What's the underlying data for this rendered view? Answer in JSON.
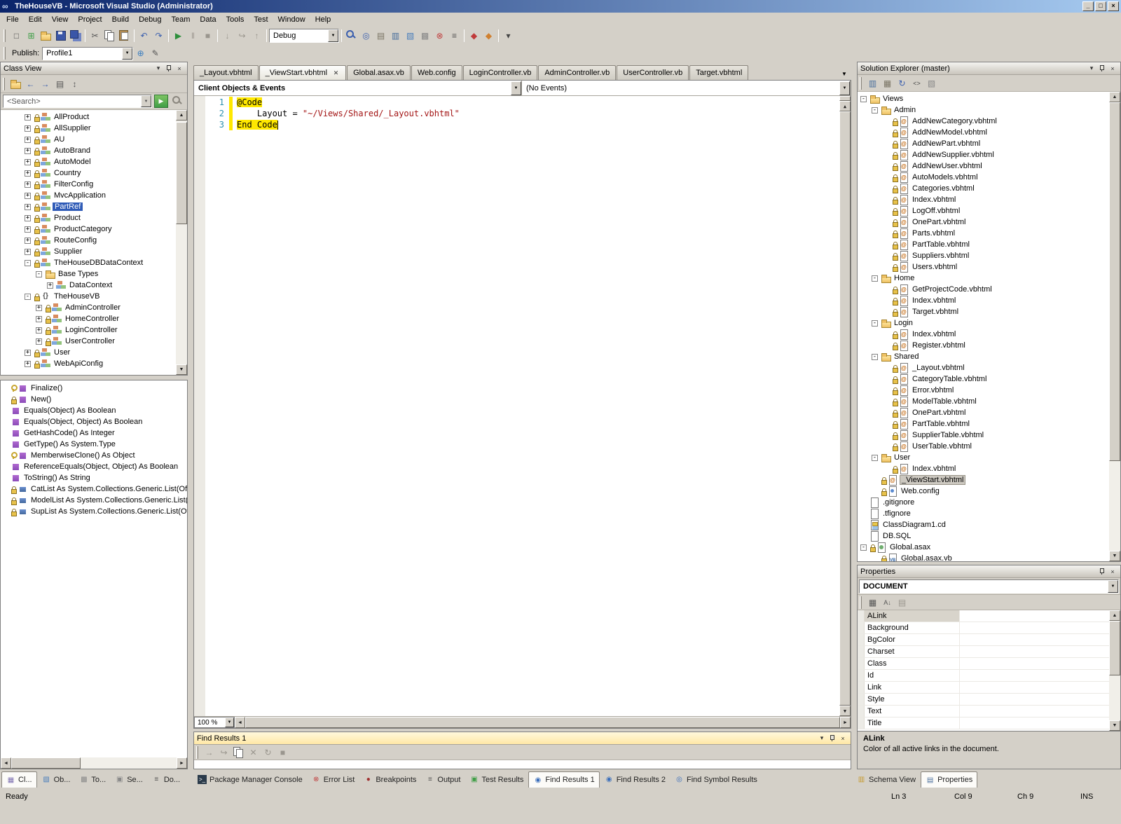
{
  "window": {
    "title": "TheHouseVB - Microsoft Visual Studio (Administrator)",
    "status": "Ready",
    "status_cells": [
      "Ln 3",
      "Col 9",
      "Ch 9",
      "INS"
    ]
  },
  "colors": {
    "titlebar_left": "#0a246a",
    "titlebar_right": "#a6caf0",
    "chrome": "#d4d0c8",
    "selection": "#2f5bb7",
    "razor_highlight": "#ffe800",
    "string_text": "#a31515",
    "line_number": "#2b91af",
    "focused_header": "#ffe8a6"
  },
  "menu": {
    "items": [
      "File",
      "Edit",
      "View",
      "Project",
      "Build",
      "Debug",
      "Team",
      "Data",
      "Tools",
      "Test",
      "Window",
      "Help"
    ]
  },
  "main_toolbar": {
    "groups_before_combo": [
      [
        "new-item",
        "add-item",
        "open-file",
        "save",
        "save-all"
      ],
      [
        "cut",
        "copy",
        "paste"
      ],
      [
        "undo",
        "redo"
      ],
      [
        "start-debugging",
        "break-all",
        "stop-debugging"
      ],
      [
        "step-into",
        "step-over",
        "step-out"
      ]
    ],
    "debug_combo": "Debug",
    "groups_after_combo": [
      [
        "find-in-files",
        "find-next",
        "solution-explorer",
        "properties-window",
        "object-browser",
        "toolbox",
        "error-list",
        "output-window"
      ],
      [
        "extension-red",
        "extension-orange"
      ],
      [
        "toolbar-options"
      ]
    ],
    "disabled": [
      "break-all",
      "stop-debugging",
      "step-into",
      "step-over",
      "step-out"
    ]
  },
  "publish_bar": {
    "label": "Publish:",
    "profile": "Profile1",
    "buttons": [
      "publish-web",
      "publish-settings"
    ]
  },
  "class_view": {
    "title": "Class View",
    "toolbar": [
      "new-folder",
      "back",
      "forward",
      "view-menu",
      "sort"
    ],
    "search_value": "<Search>",
    "tree": [
      {
        "label": "AllProduct",
        "level": 0,
        "exp": "+",
        "icon": "class",
        "lock": true
      },
      {
        "label": "AllSupplier",
        "level": 0,
        "exp": "+",
        "icon": "class",
        "lock": true
      },
      {
        "label": "AU",
        "level": 0,
        "exp": "+",
        "icon": "class",
        "lock": true
      },
      {
        "label": "AutoBrand",
        "level": 0,
        "exp": "+",
        "icon": "class",
        "lock": true
      },
      {
        "label": "AutoModel",
        "level": 0,
        "exp": "+",
        "icon": "class",
        "lock": true
      },
      {
        "label": "Country",
        "level": 0,
        "exp": "+",
        "icon": "class",
        "lock": true
      },
      {
        "label": "FilterConfig",
        "level": 0,
        "exp": "+",
        "icon": "class",
        "lock": true
      },
      {
        "label": "MvcApplication",
        "level": 0,
        "exp": "+",
        "icon": "class",
        "lock": true
      },
      {
        "label": "PartRef",
        "level": 0,
        "exp": "+",
        "icon": "class",
        "lock": true,
        "selected": true
      },
      {
        "label": "Product",
        "level": 0,
        "exp": "+",
        "icon": "class",
        "lock": true
      },
      {
        "label": "ProductCategory",
        "level": 0,
        "exp": "+",
        "icon": "class",
        "lock": true
      },
      {
        "label": "RouteConfig",
        "level": 0,
        "exp": "+",
        "icon": "class",
        "lock": true
      },
      {
        "label": "Supplier",
        "level": 0,
        "exp": "+",
        "icon": "class",
        "lock": true
      },
      {
        "label": "TheHouseDBDataContext",
        "level": 0,
        "exp": "-",
        "icon": "class",
        "lock": true
      },
      {
        "label": "Base Types",
        "level": 1,
        "exp": "-",
        "icon": "folder"
      },
      {
        "label": "DataContext",
        "level": 2,
        "exp": "+",
        "icon": "class"
      },
      {
        "label": "TheHouseVB",
        "level": 0,
        "exp": "-",
        "icon": "namespace",
        "lock": true
      },
      {
        "label": "AdminController",
        "level": 1,
        "exp": "+",
        "icon": "class",
        "lock": true
      },
      {
        "label": "HomeController",
        "level": 1,
        "exp": "+",
        "icon": "class",
        "lock": true
      },
      {
        "label": "LoginController",
        "level": 1,
        "exp": "+",
        "icon": "class",
        "lock": true
      },
      {
        "label": "UserController",
        "level": 1,
        "exp": "+",
        "icon": "class",
        "lock": true
      },
      {
        "label": "User",
        "level": 0,
        "exp": "+",
        "icon": "class",
        "lock": true
      },
      {
        "label": "WebApiConfig",
        "level": 0,
        "exp": "+",
        "icon": "class",
        "lock": true
      }
    ],
    "members": [
      {
        "label": "Finalize()",
        "icon": "method",
        "modifier": "protected"
      },
      {
        "label": "New()",
        "icon": "method",
        "modifier": "friend"
      },
      {
        "label": "Equals(Object) As Boolean",
        "icon": "method"
      },
      {
        "label": "Equals(Object, Object) As Boolean",
        "icon": "method"
      },
      {
        "label": "GetHashCode() As Integer",
        "icon": "method"
      },
      {
        "label": "GetType() As System.Type",
        "icon": "method"
      },
      {
        "label": "MemberwiseClone() As Object",
        "icon": "method",
        "modifier": "protected"
      },
      {
        "label": "ReferenceEquals(Object, Object) As Boolean",
        "icon": "method"
      },
      {
        "label": "ToString() As String",
        "icon": "method"
      },
      {
        "label": "CatList As System.Collections.Generic.List(Of",
        "icon": "property",
        "modifier": "friend"
      },
      {
        "label": "ModelList As System.Collections.Generic.List(",
        "icon": "property",
        "modifier": "friend"
      },
      {
        "label": "SupList As System.Collections.Generic.List(Of",
        "icon": "property",
        "modifier": "friend"
      }
    ]
  },
  "editor": {
    "tabs": [
      {
        "label": "_Layout.vbhtml"
      },
      {
        "label": "_ViewStart.vbhtml",
        "active": true,
        "close": true
      },
      {
        "label": "Global.asax.vb"
      },
      {
        "label": "Web.config"
      },
      {
        "label": "LoginController.vb"
      },
      {
        "label": "AdminController.vb"
      },
      {
        "label": "UserController.vb"
      },
      {
        "label": "Target.vbhtml"
      }
    ],
    "nav_left": "Client Objects & Events",
    "nav_right": "(No Events)",
    "code_lines": [
      {
        "num": "1",
        "segments": [
          {
            "text": "@Code",
            "style": "razor"
          }
        ]
      },
      {
        "num": "2",
        "segments": [
          {
            "text": "    Layout = ",
            "style": "plain"
          },
          {
            "text": "\"~/Views/Shared/_Layout.vbhtml\"",
            "style": "string"
          }
        ]
      },
      {
        "num": "3",
        "segments": [
          {
            "text": "End Code",
            "style": "razor"
          }
        ],
        "caret": true
      }
    ],
    "zoom": "100 %"
  },
  "find_results": {
    "title": "Find Results 1",
    "toolbar": [
      "goto-location",
      "goto-next",
      "copy-results",
      "clear-results",
      "repeat-search",
      "stop-search"
    ]
  },
  "solution_explorer": {
    "title": "Solution Explorer (master)",
    "toolbar": [
      "show-properties",
      "show-all-files",
      "refresh",
      "view-code",
      "view-designer"
    ],
    "tree": [
      {
        "label": "Views",
        "level": 0,
        "exp": "-",
        "icon": "folder"
      },
      {
        "label": "Admin",
        "level": 1,
        "exp": "-",
        "icon": "folder"
      },
      {
        "label": "AddNewCategory.vbhtml",
        "level": 2,
        "icon": "razor",
        "lock": true
      },
      {
        "label": "AddNewModel.vbhtml",
        "level": 2,
        "icon": "razor",
        "lock": true
      },
      {
        "label": "AddNewPart.vbhtml",
        "level": 2,
        "icon": "razor",
        "lock": true
      },
      {
        "label": "AddNewSupplier.vbhtml",
        "level": 2,
        "icon": "razor",
        "lock": true
      },
      {
        "label": "AddNewUser.vbhtml",
        "level": 2,
        "icon": "razor",
        "lock": true
      },
      {
        "label": "AutoModels.vbhtml",
        "level": 2,
        "icon": "razor",
        "lock": true
      },
      {
        "label": "Categories.vbhtml",
        "level": 2,
        "icon": "razor",
        "lock": true
      },
      {
        "label": "Index.vbhtml",
        "level": 2,
        "icon": "razor",
        "lock": true
      },
      {
        "label": "LogOff.vbhtml",
        "level": 2,
        "icon": "razor",
        "lock": true
      },
      {
        "label": "OnePart.vbhtml",
        "level": 2,
        "icon": "razor",
        "lock": true
      },
      {
        "label": "Parts.vbhtml",
        "level": 2,
        "icon": "razor",
        "lock": true
      },
      {
        "label": "PartTable.vbhtml",
        "level": 2,
        "icon": "razor",
        "lock": true
      },
      {
        "label": "Suppliers.vbhtml",
        "level": 2,
        "icon": "razor",
        "lock": true
      },
      {
        "label": "Users.vbhtml",
        "level": 2,
        "icon": "razor",
        "lock": true
      },
      {
        "label": "Home",
        "level": 1,
        "exp": "-",
        "icon": "folder"
      },
      {
        "label": "GetProjectCode.vbhtml",
        "level": 2,
        "icon": "razor",
        "lock": true
      },
      {
        "label": "Index.vbhtml",
        "level": 2,
        "icon": "razor",
        "lock": true
      },
      {
        "label": "Target.vbhtml",
        "level": 2,
        "icon": "razor",
        "lock": true
      },
      {
        "label": "Login",
        "level": 1,
        "exp": "-",
        "icon": "folder"
      },
      {
        "label": "Index.vbhtml",
        "level": 2,
        "icon": "razor",
        "lock": true
      },
      {
        "label": "Register.vbhtml",
        "level": 2,
        "icon": "razor",
        "lock": true
      },
      {
        "label": "Shared",
        "level": 1,
        "exp": "-",
        "icon": "folder"
      },
      {
        "label": "_Layout.vbhtml",
        "level": 2,
        "icon": "razor",
        "lock": true
      },
      {
        "label": "CategoryTable.vbhtml",
        "level": 2,
        "icon": "razor",
        "lock": true
      },
      {
        "label": "Error.vbhtml",
        "level": 2,
        "icon": "razor",
        "lock": true
      },
      {
        "label": "ModelTable.vbhtml",
        "level": 2,
        "icon": "razor",
        "lock": true
      },
      {
        "label": "OnePart.vbhtml",
        "level": 2,
        "icon": "razor",
        "lock": true
      },
      {
        "label": "PartTable.vbhtml",
        "level": 2,
        "icon": "razor",
        "lock": true
      },
      {
        "label": "SupplierTable.vbhtml",
        "level": 2,
        "icon": "razor",
        "lock": true
      },
      {
        "label": "UserTable.vbhtml",
        "level": 2,
        "icon": "razor",
        "lock": true
      },
      {
        "label": "User",
        "level": 1,
        "exp": "-",
        "icon": "folder"
      },
      {
        "label": "Index.vbhtml",
        "level": 2,
        "icon": "razor",
        "lock": true
      },
      {
        "label": "_ViewStart.vbhtml",
        "level": 1,
        "icon": "razor",
        "lock": true,
        "selected": true
      },
      {
        "label": "Web.config",
        "level": 1,
        "icon": "config",
        "lock": true
      },
      {
        "label": ".gitignore",
        "level": 0,
        "icon": "file"
      },
      {
        "label": ".tfignore",
        "level": 0,
        "icon": "file"
      },
      {
        "label": "ClassDiagram1.cd",
        "level": 0,
        "icon": "diagram"
      },
      {
        "label": "DB.SQL",
        "level": 0,
        "icon": "file"
      },
      {
        "label": "Global.asax",
        "level": 0,
        "exp": "-",
        "icon": "asax",
        "lock": true
      },
      {
        "label": "Global.asax.vb",
        "level": 1,
        "icon": "vb",
        "lock": true
      }
    ]
  },
  "properties": {
    "title": "Properties",
    "object_name": "DOCUMENT",
    "toolbar": [
      "categorized",
      "alphabetical",
      "property-pages"
    ],
    "rows": [
      {
        "name": "ALink",
        "value": "",
        "selected": true
      },
      {
        "name": "Background",
        "value": ""
      },
      {
        "name": "BgColor",
        "value": ""
      },
      {
        "name": "Charset",
        "value": ""
      },
      {
        "name": "Class",
        "value": ""
      },
      {
        "name": "Id",
        "value": ""
      },
      {
        "name": "Link",
        "value": ""
      },
      {
        "name": "Style",
        "value": ""
      },
      {
        "name": "Text",
        "value": ""
      },
      {
        "name": "Title",
        "value": ""
      }
    ],
    "description_title": "ALink",
    "description_text": "Color of all active links in the document."
  },
  "bottom_tabs": {
    "left": [
      {
        "label": "Cl...",
        "icon": "class-view",
        "active": true
      },
      {
        "label": "Ob...",
        "icon": "object-browser"
      },
      {
        "label": "To...",
        "icon": "toolbox"
      },
      {
        "label": "Se...",
        "icon": "server-explorer"
      },
      {
        "label": "Do...",
        "icon": "document-outline"
      }
    ],
    "center": [
      {
        "label": "Package Manager Console",
        "icon": "console"
      },
      {
        "label": "Error List",
        "icon": "error-list"
      },
      {
        "label": "Breakpoints",
        "icon": "breakpoint"
      },
      {
        "label": "Output",
        "icon": "output"
      },
      {
        "label": "Test Results",
        "icon": "test-results"
      },
      {
        "label": "Find Results 1",
        "icon": "find-results",
        "active": true
      },
      {
        "label": "Find Results 2",
        "icon": "find-results"
      },
      {
        "label": "Find Symbol Results",
        "icon": "find-symbol"
      }
    ],
    "right": [
      {
        "label": "Schema View",
        "icon": "schema-view"
      },
      {
        "label": "Properties",
        "icon": "properties",
        "active": true
      }
    ]
  }
}
